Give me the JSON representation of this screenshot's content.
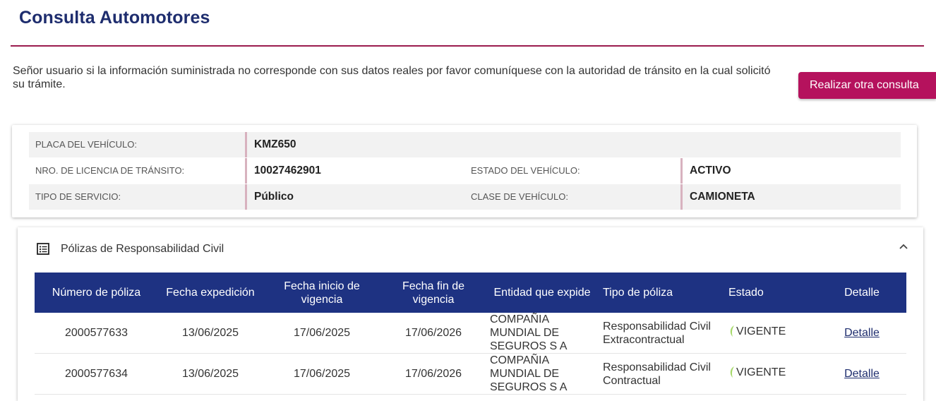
{
  "page": {
    "title": "Consulta Automotores",
    "notice": "Señor usuario si la información suministrada no corresponde con sus datos reales por favor comuníquese con la autoridad de tránsito en la cual solicitó su trámite.",
    "new_query_button": "Realizar otra consulta"
  },
  "vehicle": {
    "placa_label": "PLACA DEL VEHÍCULO:",
    "placa_value": "KMZ650",
    "licencia_label": "NRO. DE LICENCIA DE TRÁNSITO:",
    "licencia_value": "10027462901",
    "estado_label": "ESTADO DEL VEHÍCULO:",
    "estado_value": "ACTIVO",
    "servicio_label": "TIPO DE SERVICIO:",
    "servicio_value": "Público",
    "clase_label": "CLASE DE VEHÍCULO:",
    "clase_value": "CAMIONETA"
  },
  "policies": {
    "section_title": "Pólizas de Responsabilidad Civil",
    "section_icon": "list-icon",
    "toggle_icon": "chevron-up-icon",
    "columns": [
      "Número de póliza",
      "Fecha expedición",
      "Fecha inicio de vigencia",
      "Fecha fin de vigencia",
      "Entidad que expide",
      "Tipo de póliza",
      "Estado",
      "Detalle"
    ],
    "rows": [
      {
        "numero": "2000577633",
        "expedicion": "13/06/2025",
        "inicio": "17/06/2025",
        "fin": "17/06/2026",
        "entidad": "COMPAÑIA MUNDIAL DE SEGUROS S A",
        "tipo": "Responsabilidad Civil Extracontractual",
        "estado": "VIGENTE",
        "detalle": "Detalle"
      },
      {
        "numero": "2000577634",
        "expedicion": "13/06/2025",
        "inicio": "17/06/2025",
        "fin": "17/06/2026",
        "entidad": "COMPAÑIA MUNDIAL DE SEGUROS S A",
        "tipo": "Responsabilidad Civil Contractual",
        "estado": "VIGENTE",
        "detalle": "Detalle"
      }
    ]
  },
  "colors": {
    "title": "#1e2d6e",
    "accent": "#b5125d",
    "rule": "#9b1c4f",
    "table_header": "#1e3282",
    "status_icon": "#a6d96a"
  }
}
